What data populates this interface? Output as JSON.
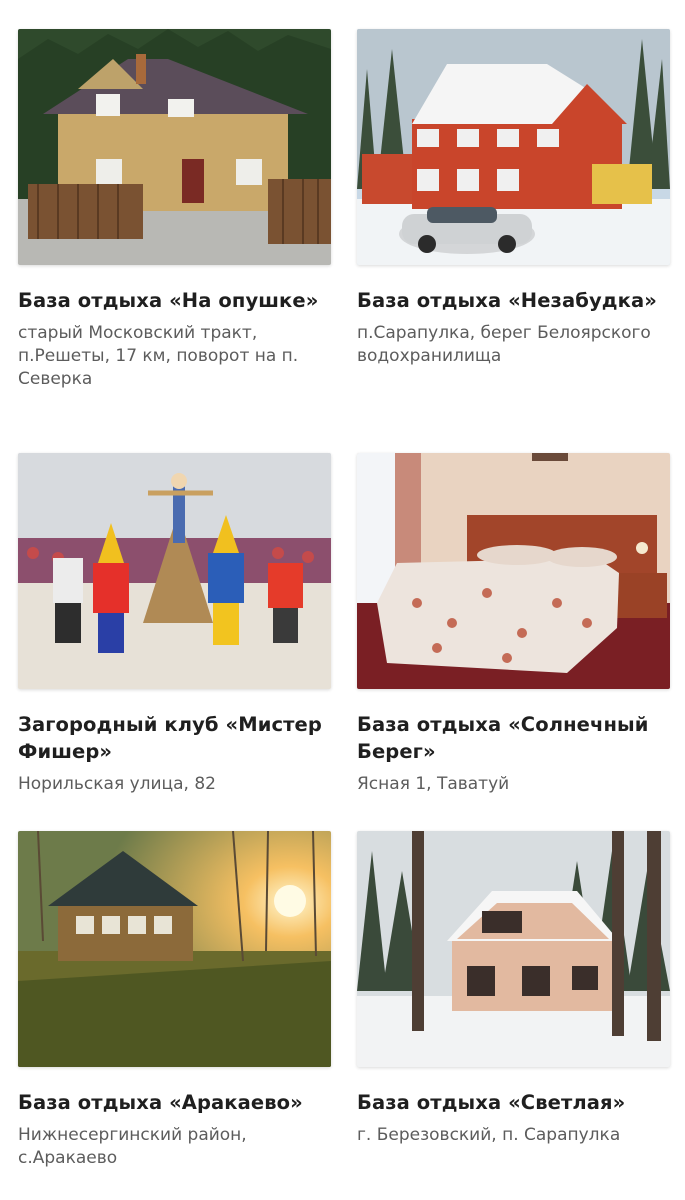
{
  "listings": [
    {
      "title": "База отдыха «На опушке»",
      "address": "старый Московский тракт, п.Решеты, 17 км, поворот на п. Северка"
    },
    {
      "title": "База отдыха «Незабудка»",
      "address": "п.Сарапулка, берег Белоярского водохранилища"
    },
    {
      "title": "Загородный клуб «Мистер Фишер»",
      "address": "Норильская улица, 82"
    },
    {
      "title": "База отдыха «Солнечный Берег»",
      "address": "Ясная 1, Таватуй"
    },
    {
      "title": "База отдыха «Аракаево»",
      "address": "Нижнесергинский район, с.Аракаево"
    },
    {
      "title": "База отдыха «Светлая»",
      "address": "г. Березовский, п. Сарапулка"
    }
  ]
}
